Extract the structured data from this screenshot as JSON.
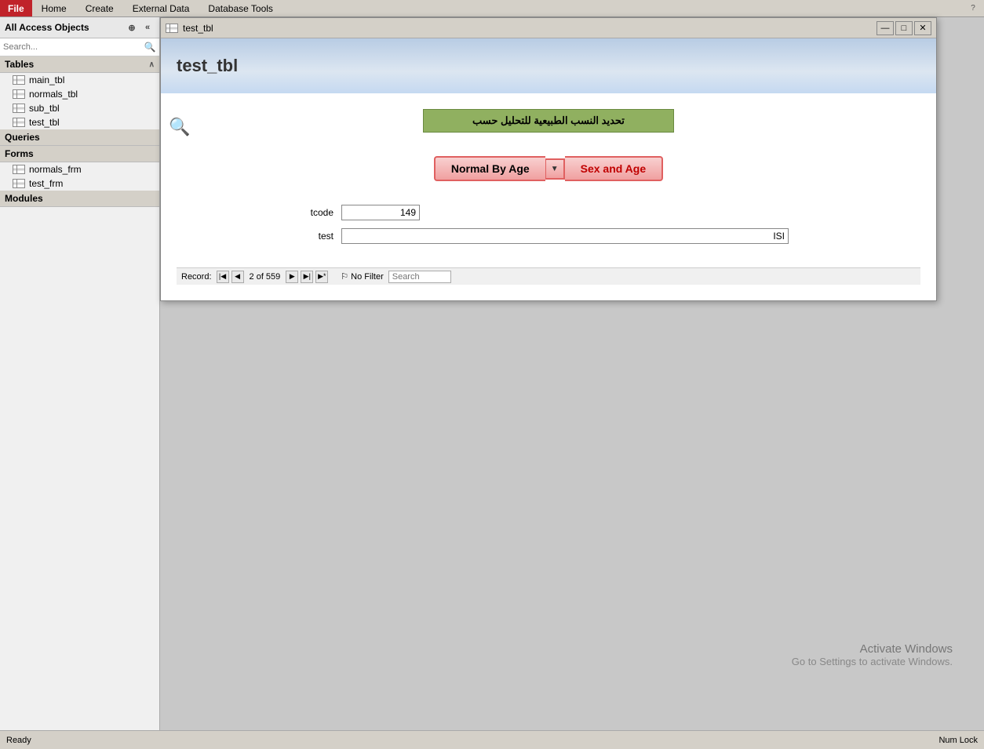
{
  "menubar": {
    "file": "File",
    "home": "Home",
    "create": "Create",
    "external_data": "External Data",
    "database_tools": "Database Tools"
  },
  "sidebar": {
    "title": "All Access Objects",
    "search_placeholder": "Search...",
    "sections": {
      "tables": {
        "label": "Tables",
        "items": [
          "main_tbl",
          "normals_tbl",
          "sub_tbl",
          "test_tbl"
        ]
      },
      "queries": {
        "label": "Queries"
      },
      "forms": {
        "label": "Forms",
        "items": [
          "normals_frm",
          "test_frm"
        ]
      },
      "modules": {
        "label": "Modules"
      }
    }
  },
  "modal": {
    "title": "test_tbl",
    "form_title": "test_tbl",
    "arabic_label": "تحديد النسب الطبيعية للتحليل حسب",
    "normal_by_age_label": "Normal By Age",
    "dropdown_arrow": "▼",
    "sex_and_age_label": "Sex and Age",
    "fields": {
      "tcode_label": "tcode",
      "tcode_value": "149",
      "test_label": "test",
      "test_value": "ISI"
    },
    "statusbar": {
      "record_label": "Record:",
      "record_info": "2 of 559",
      "no_filter": "No Filter",
      "search": "Search"
    },
    "controls": {
      "minimize": "—",
      "maximize": "□",
      "close": "✕"
    }
  },
  "bottom_bar": {
    "status": "Ready",
    "num_lock": "Num Lock"
  },
  "activate_windows": {
    "title": "Activate Windows",
    "subtitle": "Go to Settings to activate Windows."
  }
}
